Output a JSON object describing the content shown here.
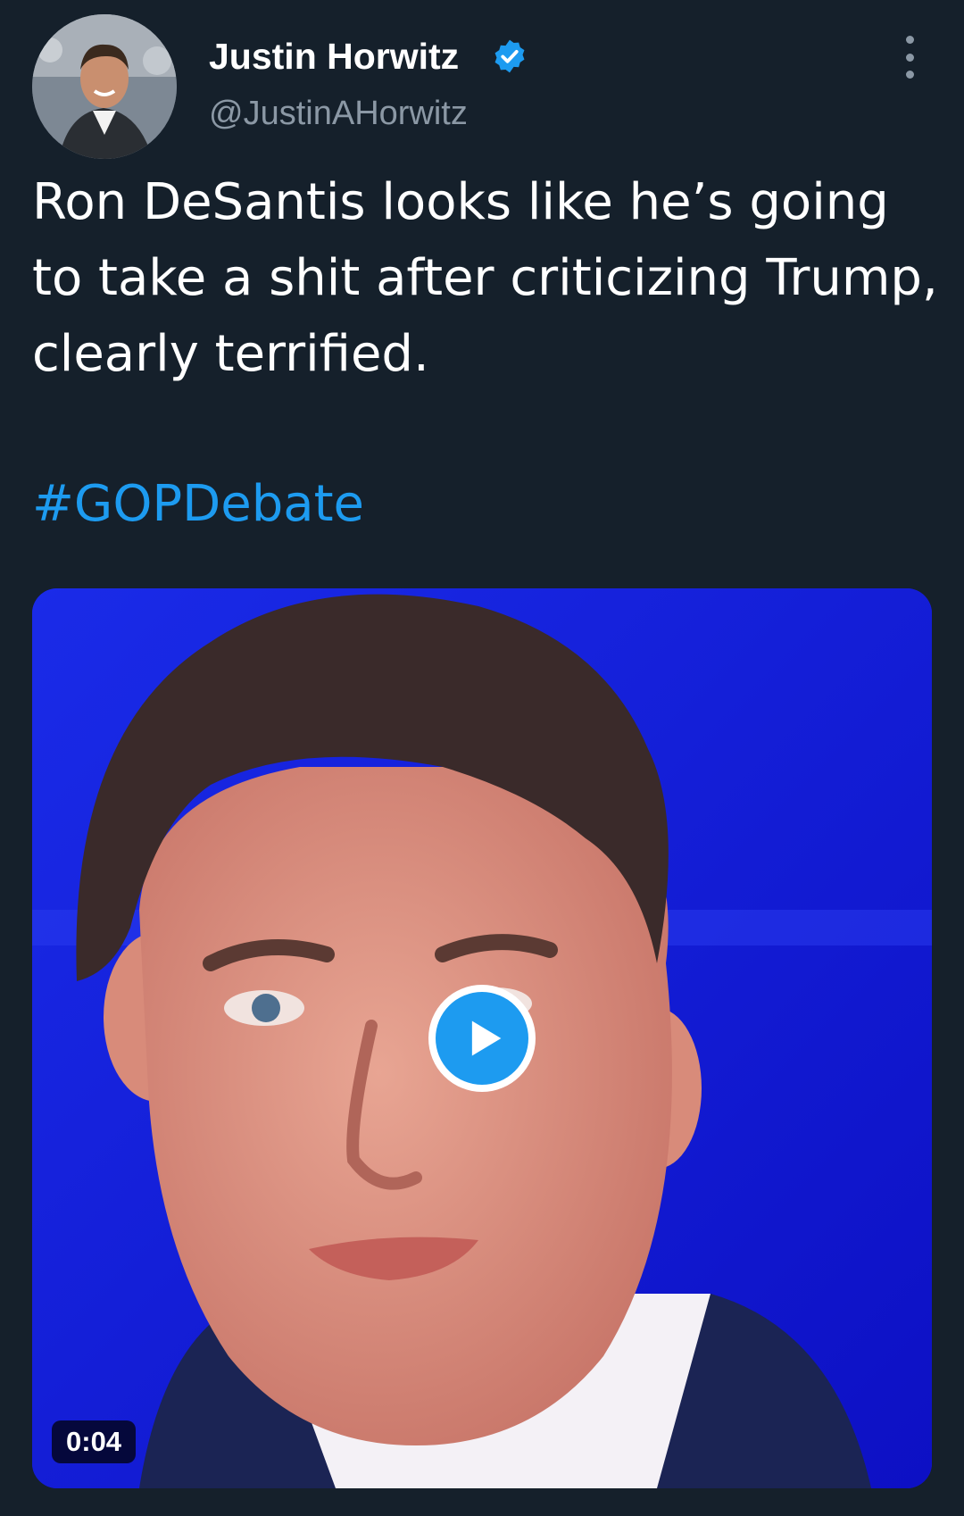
{
  "author": {
    "display_name": "Justin Horwitz",
    "handle": "@JustinAHorwitz",
    "verified": true
  },
  "tweet": {
    "text": "Ron DeSantis looks like he’s going to take a shit after criticizing Trump, clearly terrified.",
    "hashtag": "#GOPDebate"
  },
  "media": {
    "type": "video",
    "duration": "0:04"
  },
  "icons": {
    "verified": "verified-badge-icon",
    "more": "more-options-icon",
    "play": "play-icon"
  },
  "colors": {
    "background": "#15202b",
    "accent": "#1d9bf0",
    "secondary_text": "#8b98a5"
  }
}
